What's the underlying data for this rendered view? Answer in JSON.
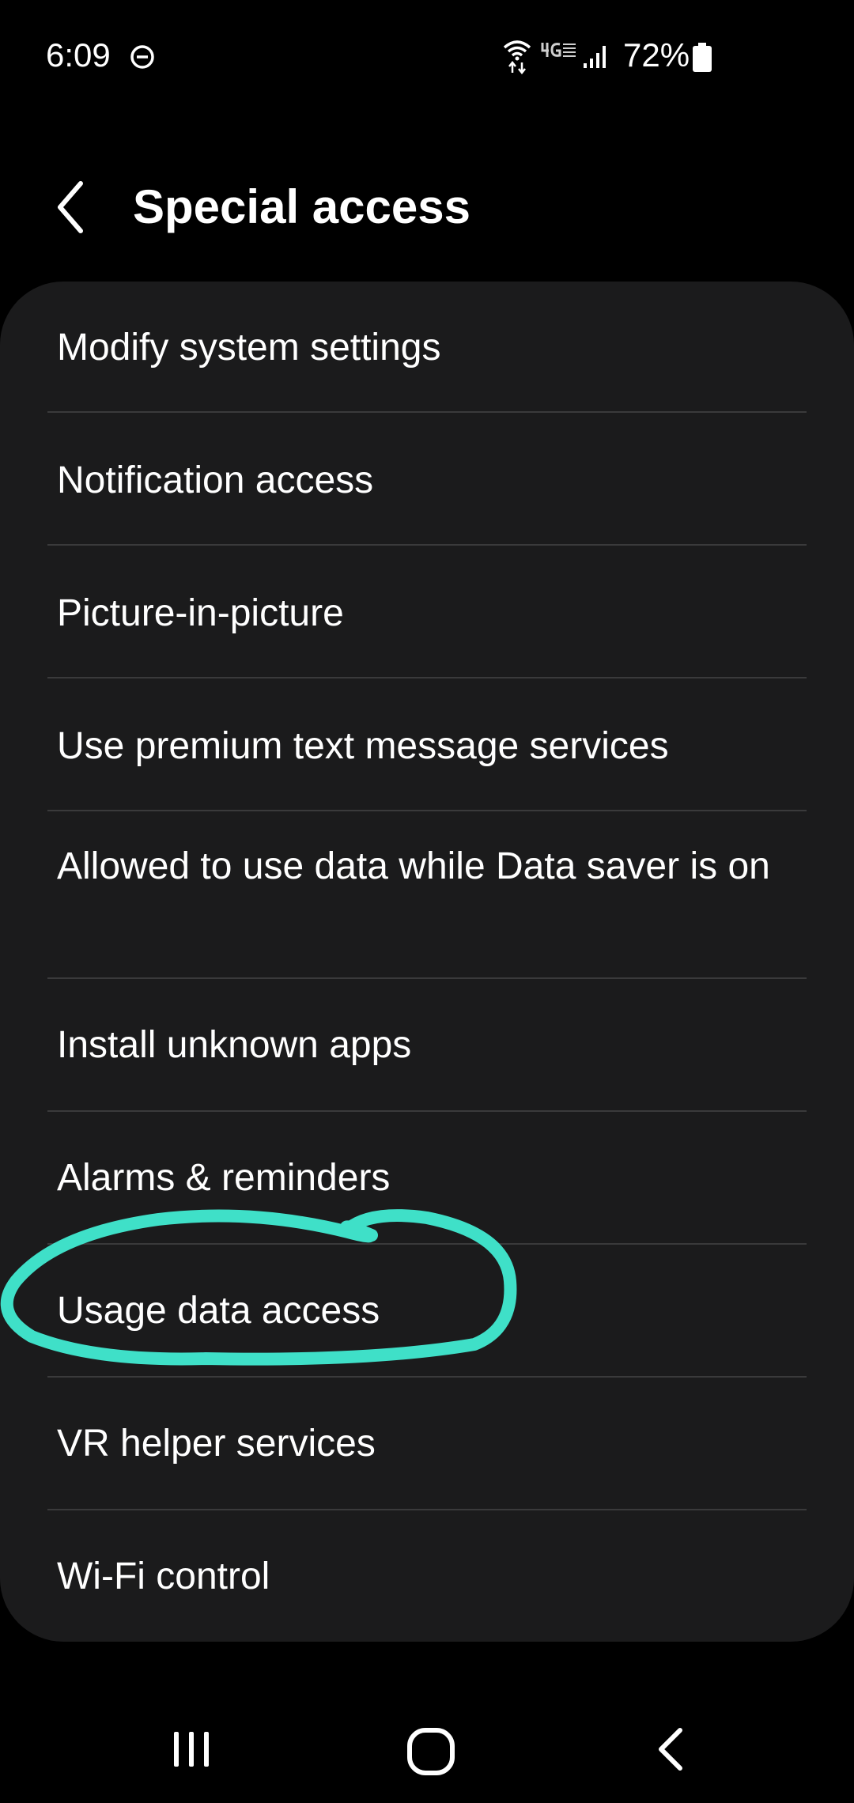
{
  "status_bar": {
    "time": "6:09",
    "battery": "72%",
    "icons": [
      "do-not-disturb-icon",
      "wifi-icon",
      "volte-icon",
      "signal-icon",
      "battery-icon"
    ]
  },
  "header": {
    "title": "Special access",
    "back_icon": "chevron-left-icon"
  },
  "list": {
    "items": [
      {
        "label": "Modify system settings"
      },
      {
        "label": "Notification access"
      },
      {
        "label": "Picture-in-picture"
      },
      {
        "label": "Use premium text message services"
      },
      {
        "label": "Allowed to use data while Data saver is on"
      },
      {
        "label": "Install unknown apps"
      },
      {
        "label": "Alarms & reminders"
      },
      {
        "label": "Usage data access"
      },
      {
        "label": "VR helper services"
      },
      {
        "label": "Wi-Fi control"
      }
    ]
  },
  "annotation": {
    "color": "#3fe0c8",
    "highlighted_item": "Usage data access"
  },
  "nav_bar": {
    "icons": [
      "recent-apps-icon",
      "home-icon",
      "back-icon"
    ]
  },
  "colors": {
    "background": "#000000",
    "card": "#1b1b1c",
    "divider": "#3a3a3b",
    "text": "#ffffff"
  }
}
